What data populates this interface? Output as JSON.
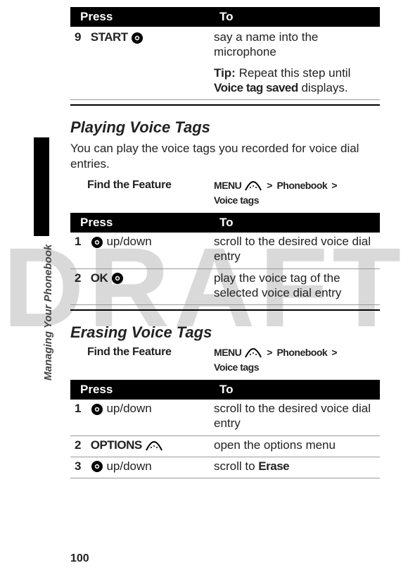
{
  "watermark": "DRAFT",
  "side_label": "Managing Your Phonebook",
  "page_number": "100",
  "table_headers": {
    "press": "Press",
    "to": "To"
  },
  "icons": {
    "round": "round-button-icon",
    "soft": "softkey-icon"
  },
  "top_table": {
    "row1": {
      "num": "9",
      "label": "START",
      "desc": "say a name into the microphone"
    },
    "row2": {
      "tip_label": "Tip:",
      "tip_prefix": " Repeat this step until ",
      "tip_bold": "Voice tag saved",
      "tip_suffix": " displays."
    }
  },
  "section_playing": {
    "heading": "Playing Voice Tags",
    "body": "You can play the voice tags you recorded for voice dial entries.",
    "find_label": "Find the Feature",
    "path": {
      "menu": "MENU",
      "p1": "Phonebook",
      "p2": "Voice tags"
    },
    "table": {
      "r1": {
        "num": "1",
        "label": " up/down",
        "desc": "scroll to the desired voice dial entry"
      },
      "r2": {
        "num": "2",
        "label": "OK",
        "desc": "play the voice tag of the selected voice dial entry"
      }
    }
  },
  "section_erasing": {
    "heading": "Erasing Voice Tags",
    "find_label": "Find the Feature",
    "path": {
      "menu": "MENU",
      "p1": "Phonebook",
      "p2": "Voice tags"
    },
    "table": {
      "r1": {
        "num": "1",
        "label": " up/down",
        "desc": "scroll to the desired voice dial entry"
      },
      "r2": {
        "num": "2",
        "label": "OPTIONS",
        "desc": "open the options menu"
      },
      "r3": {
        "num": "3",
        "label": " up/down",
        "desc_prefix": "scroll to ",
        "desc_bold": "Erase"
      }
    }
  }
}
